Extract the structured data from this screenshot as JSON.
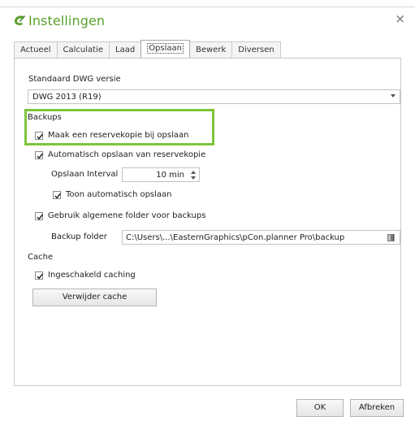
{
  "window": {
    "title": "Instellingen",
    "close_glyph": "×",
    "accent_color": "#5aa02c",
    "highlight_color": "#7cc53a"
  },
  "tabs": [
    {
      "label": "Actueel"
    },
    {
      "label": "Calculatie"
    },
    {
      "label": "Laad"
    },
    {
      "label": "Opslaan",
      "active": true
    },
    {
      "label": "Bewerk"
    },
    {
      "label": "Diversen"
    }
  ],
  "dwg": {
    "label": "Standaard DWG versie",
    "selected": "DWG 2013 (R19)"
  },
  "backups": {
    "section_label": "Backups",
    "make_backup": {
      "label": "Maak een reservekopie bij opslaan",
      "checked": true
    },
    "auto_save": {
      "label": "Automatisch opslaan van reservekopie",
      "checked": true
    },
    "interval_label": "Opslaan Interval",
    "interval_value": "10 min",
    "show_auto_save": {
      "label": "Toon automatisch opslaan",
      "checked": true
    },
    "general_folder": {
      "label": "Gebruik algemene folder voor backups",
      "checked": true
    },
    "folder_label": "Backup folder",
    "folder_value": "C:\\Users\\...\\EasternGraphics\\pCon.planner Pro\\backup"
  },
  "cache": {
    "section_label": "Cache",
    "enabled": {
      "label": "Ingeschakeld caching",
      "checked": true
    },
    "clear_button": "Verwijder cache"
  },
  "footer": {
    "ok": "OK",
    "cancel": "Afbreken"
  },
  "icons": {
    "logo": "pcon-logo-icon",
    "close": "close-icon",
    "dropdown": "chevron-down-icon",
    "spin_up": "spin-up-icon",
    "spin_down": "spin-down-icon",
    "browse": "folder-browse-icon"
  }
}
